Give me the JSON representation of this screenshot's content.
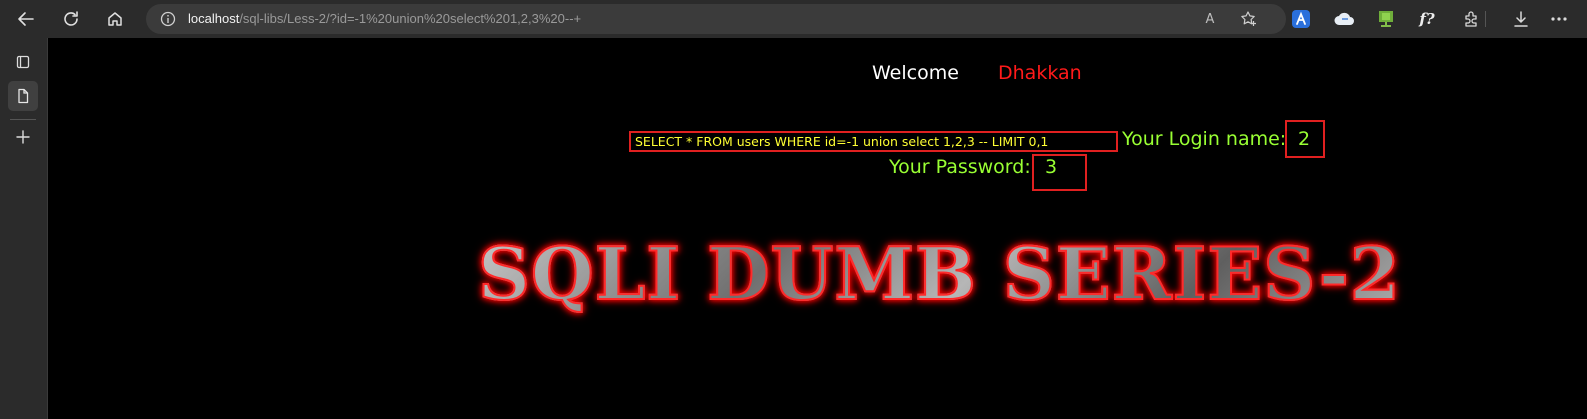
{
  "browser": {
    "url_host": "localhost",
    "url_path": "/sql-libs/Less-2/?id=-1%20union%20select%201,2,3%20--+",
    "read_aloud_label": "A",
    "extension_fx_label": "f?"
  },
  "page": {
    "welcome_label": "Welcome",
    "welcome_name": "Dhakkan",
    "query_text": "SELECT * FROM users WHERE id=-1 union select 1,2,3 -- LIMIT 0,1",
    "login_label": "Your Login name:",
    "login_value": "2",
    "password_label": "Your Password:",
    "password_value": "3",
    "banner_text": "SQLI DUMB SERIES-2"
  },
  "colors": {
    "page_background": "#000000",
    "welcome": "#ffffff",
    "welcome_name": "#ff1a1a",
    "query": "#ffff33",
    "result_text": "#99ff33",
    "highlight_box": "#e02020",
    "banner_outline": "#ff2a2a"
  },
  "icons": [
    "back-icon",
    "refresh-icon",
    "home-icon",
    "info-icon",
    "read-aloud-icon",
    "favorite-add-icon",
    "extension-a-icon",
    "cloud-icon",
    "monitor-icon",
    "formula-icon",
    "extensions-icon",
    "download-icon",
    "more-icon",
    "tab-actions-icon",
    "page-icon",
    "add-icon"
  ]
}
